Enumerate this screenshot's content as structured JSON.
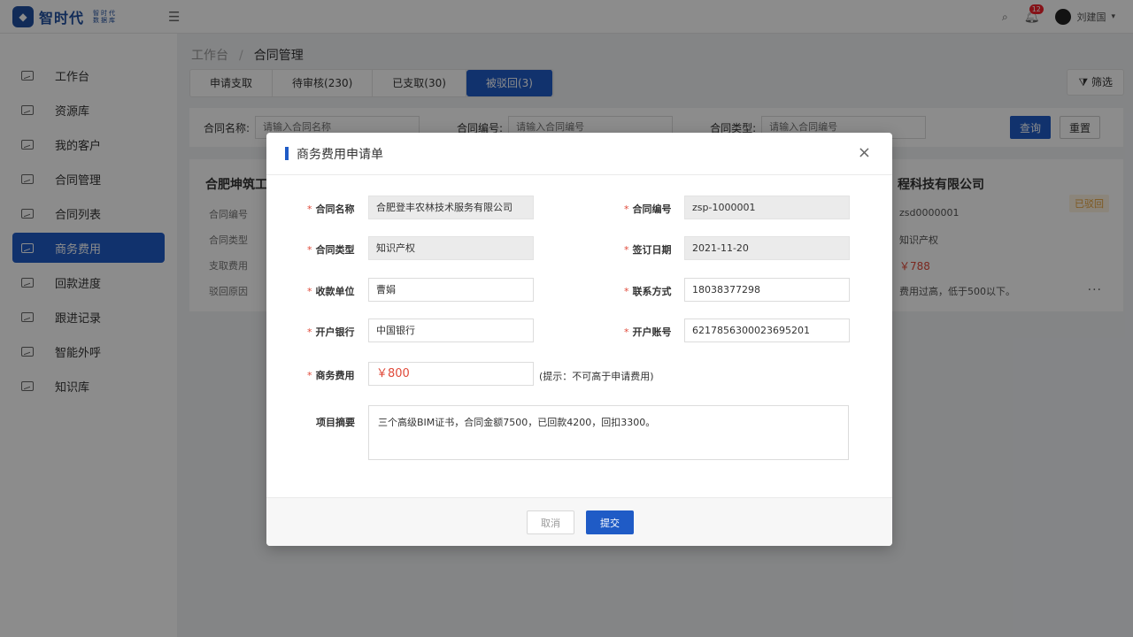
{
  "app": {
    "logo_text": "智时代",
    "logo_sub": "智时代数据库",
    "notifications": "12",
    "user_name": "刘建国"
  },
  "sidebar": {
    "items": [
      {
        "label": "工作台"
      },
      {
        "label": "资源库"
      },
      {
        "label": "我的客户"
      },
      {
        "label": "合同管理"
      },
      {
        "label": "合同列表"
      },
      {
        "label": "商务费用"
      },
      {
        "label": "回款进度"
      },
      {
        "label": "跟进记录"
      },
      {
        "label": "智能外呼"
      },
      {
        "label": "知识库"
      }
    ],
    "active_index": 5
  },
  "breadcrumb": {
    "root": "工作台",
    "sep": "/",
    "current": "合同管理"
  },
  "tabs": [
    {
      "label": "申请支取"
    },
    {
      "label": "待审核(230)"
    },
    {
      "label": "已支取(30)"
    },
    {
      "label": "被驳回(3)"
    }
  ],
  "filter_label": "筛选",
  "search": {
    "name_label": "合同名称:",
    "name_placeholder": "请输入合同名称",
    "number_label": "合同编号:",
    "number_placeholder": "请输入合同编号",
    "type_label": "合同类型:",
    "type_placeholder": "请输入合同编号",
    "query_label": "查询",
    "reset_label": "重置"
  },
  "card": {
    "left_title": "合肥坤筑工",
    "left_rows": [
      "合同编号",
      "合同类型",
      "支取费用",
      "驳回原因"
    ],
    "right_title": "程科技有限公司",
    "status": "已驳回",
    "right_rows": [
      "zsd0000001",
      "知识产权",
      "￥788",
      "费用过高，低于500以下。"
    ],
    "more": "···"
  },
  "modal": {
    "title": "商务费用申请单",
    "close": "×",
    "fields": {
      "contract_name_label": "合同名称",
      "contract_name": "合肥登丰农林技术服务有限公司",
      "contract_no_label": "合同编号",
      "contract_no": "zsp-1000001",
      "contract_type_label": "合同类型",
      "contract_type": "知识产权",
      "sign_date_label": "签订日期",
      "sign_date": "2021-11-20",
      "payee_label": "收款单位",
      "payee": "曹娟",
      "contact_label": "联系方式",
      "contact": "18038377298",
      "bank_label": "开户银行",
      "bank": "中国银行",
      "account_label": "开户账号",
      "account": "6217856300023695201",
      "fee_label": "商务费用",
      "fee": "￥800",
      "fee_hint": "(提示：不可高于申请费用)",
      "summary_label": "项目摘要",
      "summary": "三个高级BIM证书，合同金额7500，已回款4200，回扣3300。"
    },
    "required_mark": "*",
    "cancel_label": "取消",
    "submit_label": "提交"
  }
}
